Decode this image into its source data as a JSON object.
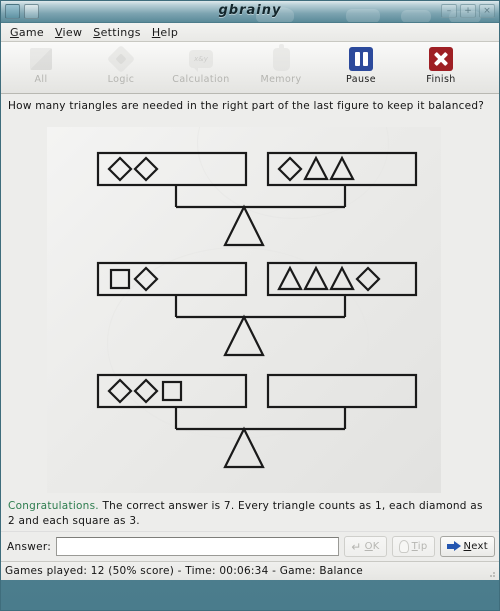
{
  "window": {
    "title": "gbrainy",
    "titlebar_buttons": [
      "minimize",
      "maximize",
      "close"
    ],
    "min_glyph": "–",
    "max_glyph": "+",
    "close_glyph": "×"
  },
  "menubar": {
    "items": [
      {
        "mnemonic": "G",
        "rest": "ame",
        "name": "game"
      },
      {
        "mnemonic": "V",
        "rest": "iew",
        "name": "view"
      },
      {
        "mnemonic": "S",
        "rest": "ettings",
        "name": "settings"
      },
      {
        "mnemonic": "H",
        "rest": "elp",
        "name": "help"
      }
    ]
  },
  "toolbar": {
    "buttons": [
      {
        "label": "All",
        "icon": "all-icon",
        "enabled": false
      },
      {
        "label": "Logic",
        "icon": "logic-icon",
        "enabled": false
      },
      {
        "label": "Calculation",
        "icon": "calculation-icon",
        "enabled": false
      },
      {
        "label": "Memory",
        "icon": "memory-icon",
        "enabled": false
      },
      {
        "label": "Pause",
        "icon": "pause-icon",
        "enabled": true
      },
      {
        "label": "Finish",
        "icon": "finish-icon",
        "enabled": true
      }
    ],
    "calc_icon_text": "x&y",
    "pause_color": "#2c4a9c",
    "finish_color": "#9e1f24"
  },
  "question": {
    "text": "How many triangles are needed in the right part of the last figure to keep it balanced?"
  },
  "puzzle": {
    "type": "balance-scales",
    "scales": [
      {
        "index": 1,
        "left": [
          "diamond",
          "diamond"
        ],
        "right": [
          "diamond",
          "triangle",
          "triangle"
        ]
      },
      {
        "index": 2,
        "left": [
          "square",
          "diamond"
        ],
        "right": [
          "triangle",
          "triangle",
          "triangle",
          "diamond"
        ]
      },
      {
        "index": 3,
        "left": [
          "diamond",
          "diamond",
          "square"
        ],
        "right": []
      }
    ],
    "stroke_color": "#1a1a1a"
  },
  "feedback": {
    "prefix": "Congratulations.",
    "prefix_color": "#2e7d4f",
    "text": " The correct answer is 7. Every triangle counts as 1, each diamond as 2 and each square as 3."
  },
  "answer": {
    "label": "Answer:",
    "value": "",
    "placeholder": ""
  },
  "buttons": {
    "ok": {
      "label": "OK",
      "mnemonic": "O",
      "rest": "K",
      "enabled": false,
      "icon": "back-arrow-icon"
    },
    "tip": {
      "label": "Tip",
      "mnemonic": "T",
      "rest": "ip",
      "enabled": false,
      "icon": "lightbulb-icon"
    },
    "next": {
      "label": "Next",
      "mnemonic": "N",
      "rest": "ext",
      "enabled": true,
      "icon": "right-arrow-icon"
    }
  },
  "statusbar": {
    "text": "Games played: 12 (50% score) - Time: 00:06:34 - Game: Balance",
    "games_played": 12,
    "score_percent": 50,
    "time": "00:06:34",
    "game": "Balance"
  }
}
